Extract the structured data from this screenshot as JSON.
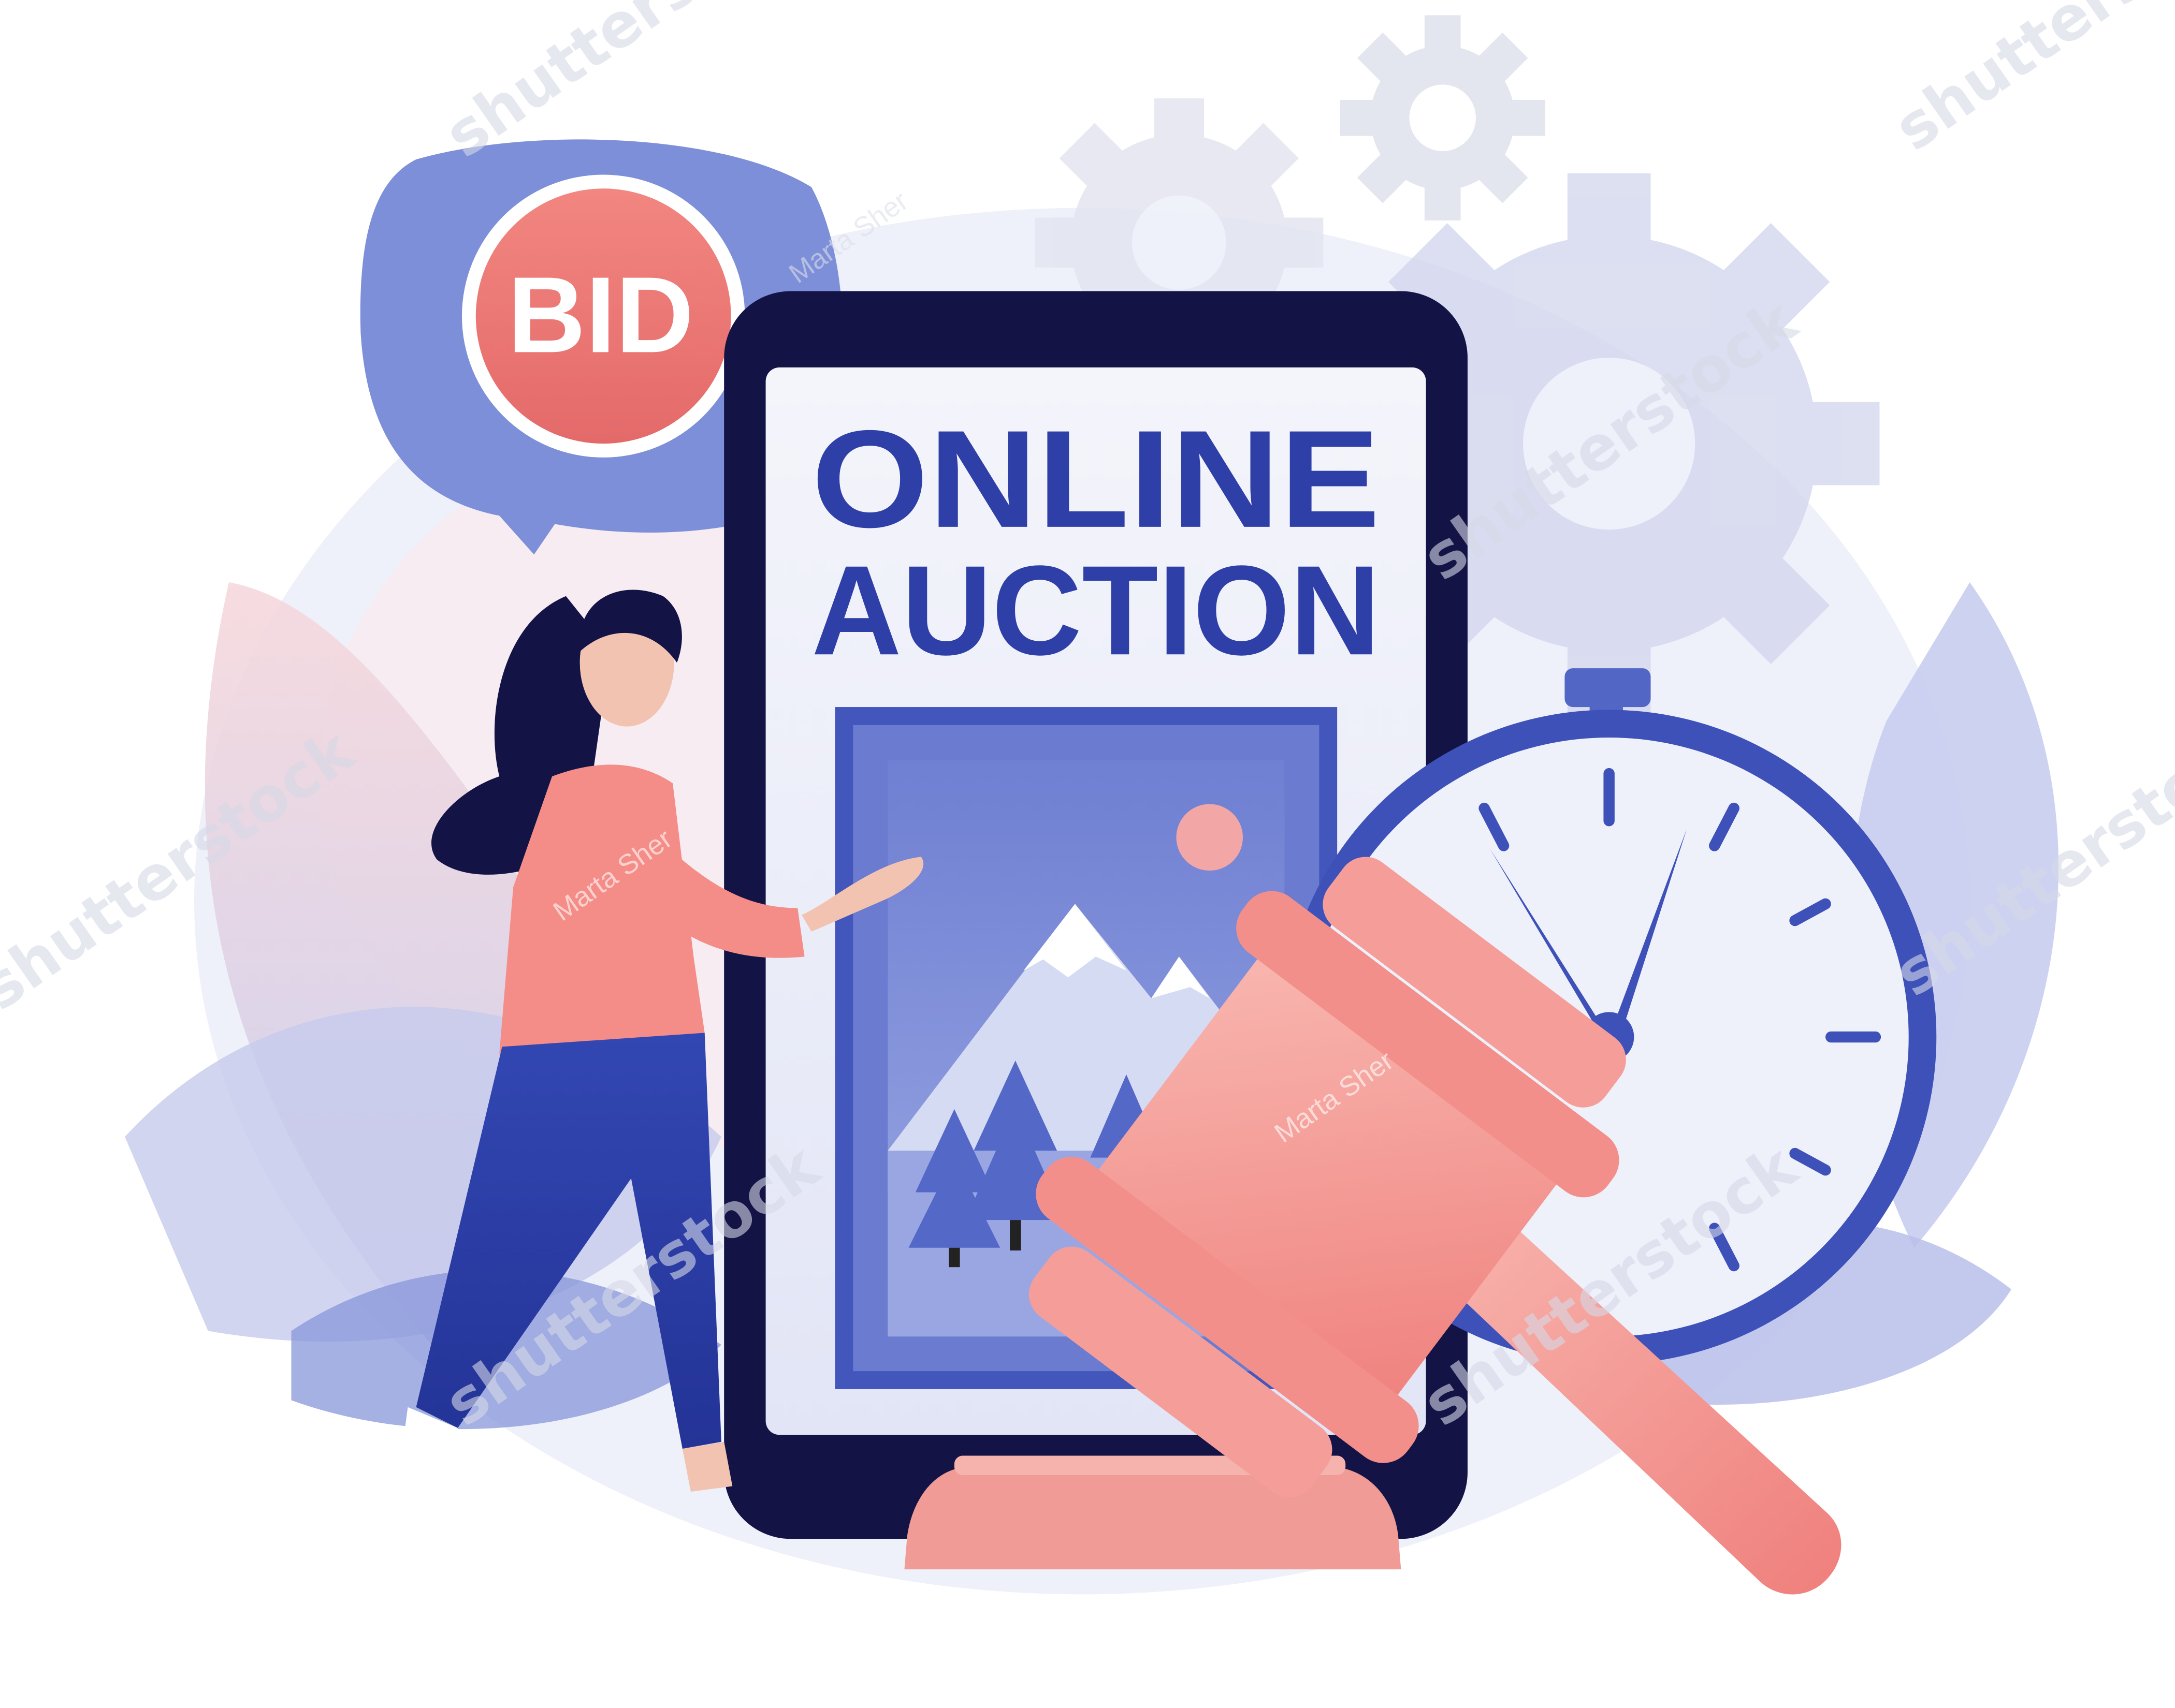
{
  "illustration": {
    "bid_badge": {
      "label": "BID"
    },
    "phone_screen": {
      "headline_line1": "ONLINE",
      "headline_line2": "AUCTION"
    }
  },
  "watermarks": {
    "brand": "shutterstock",
    "author": "Marta Sher"
  },
  "colors": {
    "accent_blue": "#2f3fa8",
    "phone_frame": "#131346",
    "coral": "#f08a86",
    "lavender": "#c7cdf0",
    "badge_red": "#e9706c"
  }
}
